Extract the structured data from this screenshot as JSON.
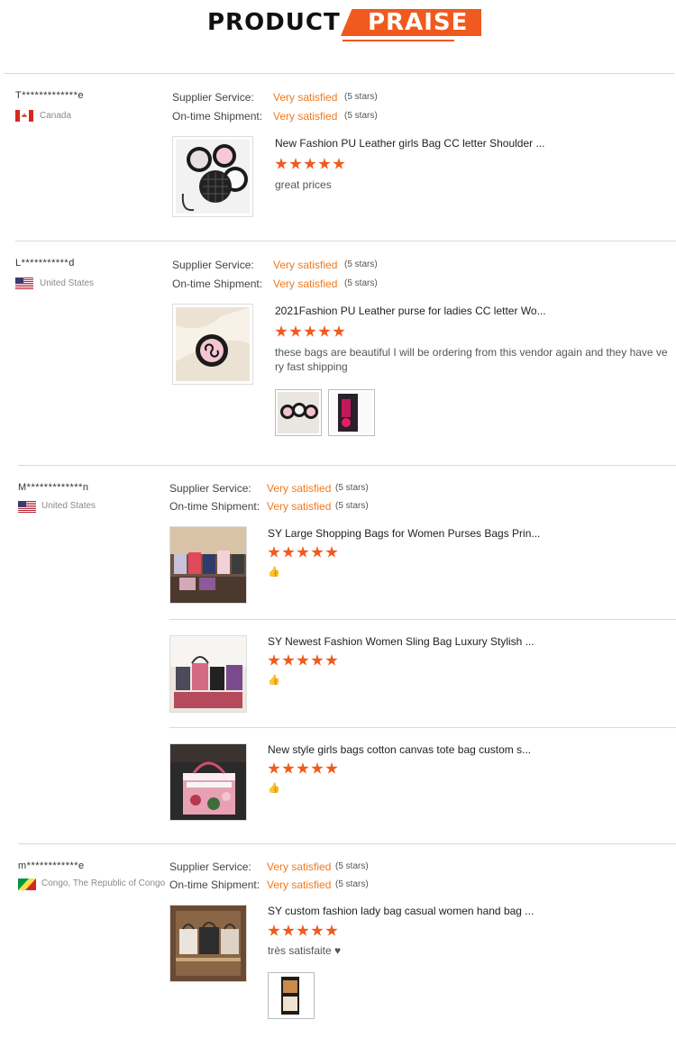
{
  "header": {
    "word1": "PRODUCT",
    "word2": "PRAISE"
  },
  "reviews": [
    {
      "user": "T*************e",
      "country": "Canada",
      "supplier_label": "Supplier Service:",
      "supplier_value": "Very satisfied",
      "supplier_stars": "(5 stars)",
      "shipment_label": "On-time Shipment:",
      "shipment_value": "Very satisfied",
      "shipment_stars": "(5 stars)",
      "items": [
        {
          "title": "New Fashion PU Leather girls Bag CC letter Shoulder ...",
          "rating": 5,
          "comment": "great prices"
        }
      ]
    },
    {
      "user": "L***********d",
      "country": "United States",
      "supplier_label": "Supplier Service:",
      "supplier_value": "Very satisfied",
      "supplier_stars": "(5 stars)",
      "shipment_label": "On-time Shipment:",
      "shipment_value": "Very satisfied",
      "shipment_stars": "(5 stars)",
      "items": [
        {
          "title": "2021Fashion PU Leather purse for ladies CC letter Wo...",
          "rating": 5,
          "comment_line1": "these bags are beautiful I will be ordering from this vendor again and they have ve",
          "comment_line2": "ry fast shipping"
        }
      ]
    },
    {
      "user": "M*************n",
      "country": "United States",
      "supplier_label": "Supplier Service:",
      "supplier_value": "Very satisfied",
      "supplier_stars": "(5 stars)",
      "shipment_label": "On-time Shipment:",
      "shipment_value": "Very satisfied",
      "shipment_stars": "(5 stars)",
      "items": [
        {
          "title": "SY Large Shopping Bags for Women Purses Bags Prin...",
          "rating": 5
        },
        {
          "title": "SY Newest Fashion Women Sling Bag Luxury Stylish ...",
          "rating": 5
        },
        {
          "title": "New style girls bags cotton canvas tote bag custom s...",
          "rating": 5
        }
      ]
    },
    {
      "user": "m************e",
      "country": "Congo, The Republic of Congo",
      "supplier_label": "Supplier Service:",
      "supplier_value": "Very satisfied",
      "supplier_stars": "(5 stars)",
      "shipment_label": "On-time Shipment:",
      "shipment_value": "Very satisfied",
      "shipment_stars": "(5 stars)",
      "items": [
        {
          "title": "SY custom fashion lady bag casual women hand bag ...",
          "rating": 5,
          "comment": "très satisfaite ♥"
        }
      ]
    }
  ],
  "colors": {
    "accent": "#f05a1e",
    "satisfied": "#f0791e"
  },
  "icons": [
    "thumbs-up-icon",
    "star-icon",
    "flag-canada-icon",
    "flag-usa-icon",
    "flag-congo-icon"
  ]
}
